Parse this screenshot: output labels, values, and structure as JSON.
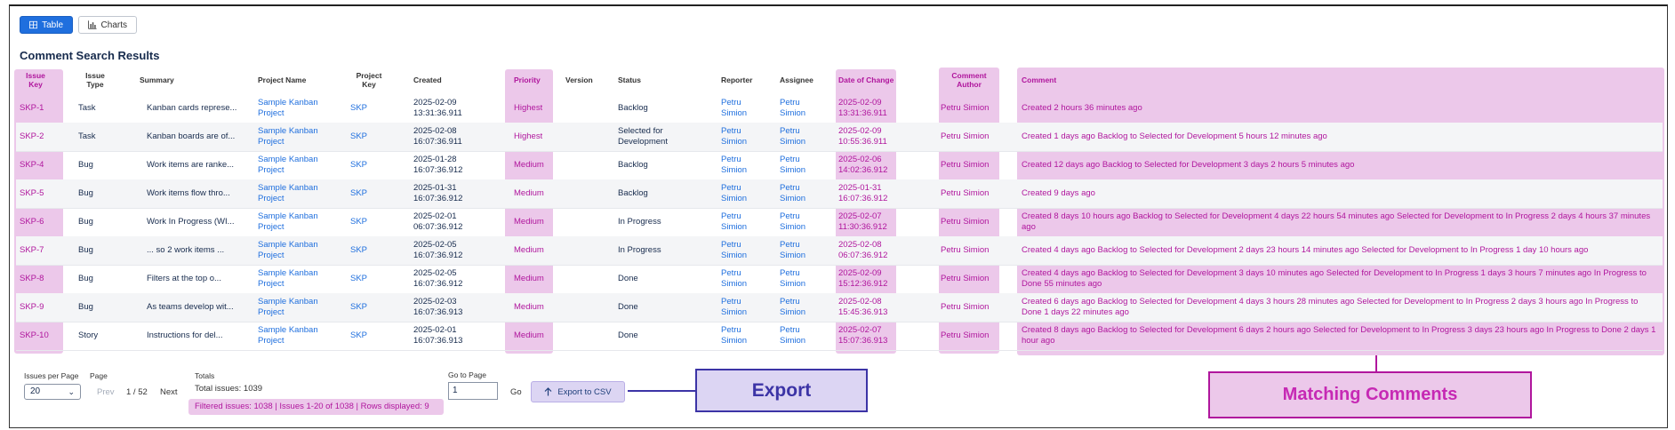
{
  "view_toggle": {
    "table_label": "Table",
    "charts_label": "Charts"
  },
  "page_title": "Comment Search Results",
  "columns": {
    "issue_key": "Issue Key",
    "issue_type": "Issue Type",
    "summary": "Summary",
    "project_name": "Project Name",
    "project_key": "Project Key",
    "created": "Created",
    "priority": "Priority",
    "version": "Version",
    "status": "Status",
    "reporter": "Reporter",
    "assignee": "Assignee",
    "date_of_change": "Date of Change",
    "comment_author": "Comment Author",
    "comment": "Comment"
  },
  "rows": [
    {
      "key": "SKP-1",
      "type": "Task",
      "summary": "Kanban cards represe...",
      "project_name": "Sample Kanban Project",
      "project_key": "SKP",
      "created": "2025-02-09 13:31:36.911",
      "priority": "Highest",
      "version": "",
      "status": "Backlog",
      "reporter": "Petru Simion",
      "assignee": "Petru Simion",
      "date_of_change": "2025-02-09 13:31:36.911",
      "comment_author": "Petru Simion",
      "comment": "Created 2 hours 36 minutes ago"
    },
    {
      "key": "SKP-2",
      "type": "Task",
      "summary": "Kanban boards are of...",
      "project_name": "Sample Kanban Project",
      "project_key": "SKP",
      "created": "2025-02-08 16:07:36.911",
      "priority": "Highest",
      "version": "",
      "status": "Selected for Development",
      "reporter": "Petru Simion",
      "assignee": "Petru Simion",
      "date_of_change": "2025-02-09 10:55:36.911",
      "comment_author": "Petru Simion",
      "comment": "Created 1 days ago Backlog to Selected for Development 5 hours 12 minutes ago"
    },
    {
      "key": "SKP-4",
      "type": "Bug",
      "summary": "Work items are ranke...",
      "project_name": "Sample Kanban Project",
      "project_key": "SKP",
      "created": "2025-01-28 16:07:36.912",
      "priority": "Medium",
      "version": "",
      "status": "Backlog",
      "reporter": "Petru Simion",
      "assignee": "Petru Simion",
      "date_of_change": "2025-02-06 14:02:36.912",
      "comment_author": "Petru Simion",
      "comment": "Created 12 days ago Backlog to Selected for Development 3 days 2 hours 5 minutes ago"
    },
    {
      "key": "SKP-5",
      "type": "Bug",
      "summary": "Work items flow thro...",
      "project_name": "Sample Kanban Project",
      "project_key": "SKP",
      "created": "2025-01-31 16:07:36.912",
      "priority": "Medium",
      "version": "",
      "status": "Backlog",
      "reporter": "Petru Simion",
      "assignee": "Petru Simion",
      "date_of_change": "2025-01-31 16:07:36.912",
      "comment_author": "Petru Simion",
      "comment": "Created 9 days ago"
    },
    {
      "key": "SKP-6",
      "type": "Bug",
      "summary": "Work In Progress (WI...",
      "project_name": "Sample Kanban Project",
      "project_key": "SKP",
      "created": "2025-02-01 06:07:36.912",
      "priority": "Medium",
      "version": "",
      "status": "In Progress",
      "reporter": "Petru Simion",
      "assignee": "Petru Simion",
      "date_of_change": "2025-02-07 11:30:36.912",
      "comment_author": "Petru Simion",
      "comment": "Created 8 days 10 hours ago Backlog to Selected for Development 4 days 22 hours 54 minutes ago Selected for Development to In Progress 2 days 4 hours 37 minutes ago"
    },
    {
      "key": "SKP-7",
      "type": "Bug",
      "summary": "... so 2 work items ...",
      "project_name": "Sample Kanban Project",
      "project_key": "SKP",
      "created": "2025-02-05 16:07:36.912",
      "priority": "Medium",
      "version": "",
      "status": "In Progress",
      "reporter": "Petru Simion",
      "assignee": "Petru Simion",
      "date_of_change": "2025-02-08 06:07:36.912",
      "comment_author": "Petru Simion",
      "comment": "Created 4 days ago Backlog to Selected for Development 2 days 23 hours 14 minutes ago Selected for Development to In Progress 1 day 10 hours ago"
    },
    {
      "key": "SKP-8",
      "type": "Bug",
      "summary": "Filters at the top o...",
      "project_name": "Sample Kanban Project",
      "project_key": "SKP",
      "created": "2025-02-05 16:07:36.912",
      "priority": "Medium",
      "version": "",
      "status": "Done",
      "reporter": "Petru Simion",
      "assignee": "Petru Simion",
      "date_of_change": "2025-02-09 15:12:36.912",
      "comment_author": "Petru Simion",
      "comment": "Created 4 days ago Backlog to Selected for Development 3 days 10 minutes ago Selected for Development to In Progress 1 days 3 hours 7 minutes ago In Progress to Done 55 minutes ago"
    },
    {
      "key": "SKP-9",
      "type": "Bug",
      "summary": "As teams develop wit...",
      "project_name": "Sample Kanban Project",
      "project_key": "SKP",
      "created": "2025-02-03 16:07:36.913",
      "priority": "Medium",
      "version": "",
      "status": "Done",
      "reporter": "Petru Simion",
      "assignee": "Petru Simion",
      "date_of_change": "2025-02-08 15:45:36.913",
      "comment_author": "Petru Simion",
      "comment": "Created 6 days ago Backlog to Selected for Development 4 days 3 hours 28 minutes ago Selected for Development to In Progress 2 days 3 hours ago In Progress to Done 1 days 22 minutes ago"
    },
    {
      "key": "SKP-10",
      "type": "Story",
      "summary": "Instructions for del...",
      "project_name": "Sample Kanban Project",
      "project_key": "SKP",
      "created": "2025-02-01 16:07:36.913",
      "priority": "Medium",
      "version": "",
      "status": "Done",
      "reporter": "Petru Simion",
      "assignee": "Petru Simion",
      "date_of_change": "2025-02-07 15:07:36.913",
      "comment_author": "Petru Simion",
      "comment": "Created 8 days ago Backlog to Selected for Development 6 days 2 hours ago Selected for Development to In Progress 3 days 23 hours ago In Progress to Done 2 days 1 hour ago"
    }
  ],
  "pagination": {
    "per_page_label": "Issues per Page",
    "per_page_value": "20",
    "page_label": "Page",
    "prev_label": "Prev",
    "page_indicator": "1 / 52",
    "next_label": "Next",
    "totals_label": "Totals",
    "total_issues": "Total issues: 1039",
    "filtered_info": "Filtered issues: 1038 | Issues 1-20 of 1038 | Rows displayed: 9",
    "goto_label": "Go to Page",
    "goto_value": "1",
    "go_label": "Go",
    "export_label": "Export to CSV"
  },
  "annotations": {
    "export": "Export",
    "matching_comments": "Matching Comments"
  },
  "colors": {
    "highlight_pink": "#ecc8ea",
    "highlight_pink_text": "#b0169d",
    "highlight_purple": "#dcd5f3",
    "highlight_purple_border": "#3c34a6",
    "primary_blue": "#1f6fde"
  }
}
